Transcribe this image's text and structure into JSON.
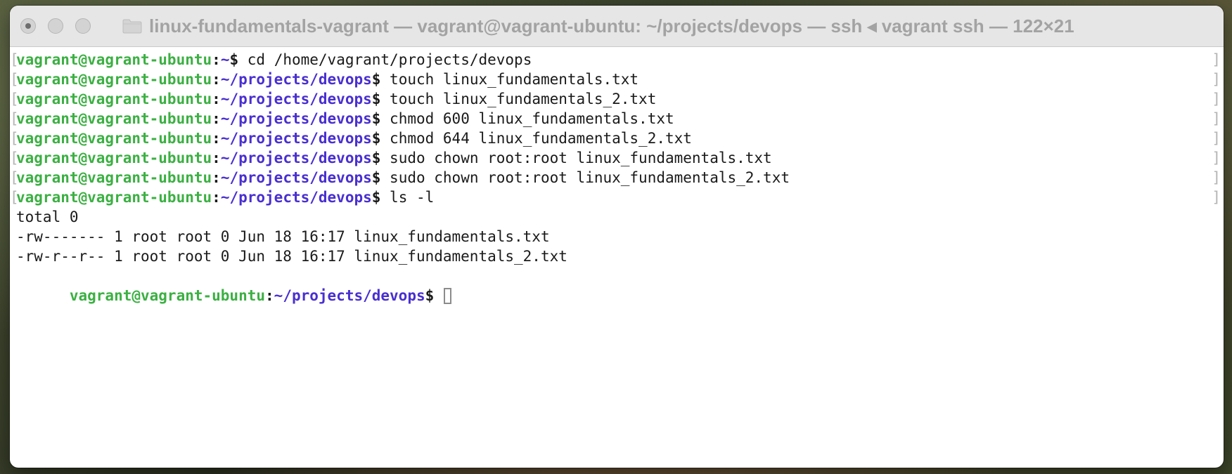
{
  "window": {
    "title": "linux-fundamentals-vagrant — vagrant@vagrant-ubuntu: ~/projects/devops — ssh ◂ vagrant ssh — 122×21",
    "traffic_lights": [
      "close",
      "minimize",
      "zoom"
    ],
    "folder_icon": "folder-icon"
  },
  "colors": {
    "user": "#3cb043",
    "path": "#4a2fd0",
    "text": "#1a1a1a"
  },
  "terminal": {
    "prompt_lines": [
      {
        "user": "vagrant@vagrant-ubuntu",
        "path": "~",
        "command": " cd /home/vagrant/projects/devops"
      },
      {
        "user": "vagrant@vagrant-ubuntu",
        "path": "~/projects/devops",
        "command": " touch linux_fundamentals.txt"
      },
      {
        "user": "vagrant@vagrant-ubuntu",
        "path": "~/projects/devops",
        "command": " touch linux_fundamentals_2.txt"
      },
      {
        "user": "vagrant@vagrant-ubuntu",
        "path": "~/projects/devops",
        "command": " chmod 600 linux_fundamentals.txt"
      },
      {
        "user": "vagrant@vagrant-ubuntu",
        "path": "~/projects/devops",
        "command": " chmod 644 linux_fundamentals_2.txt"
      },
      {
        "user": "vagrant@vagrant-ubuntu",
        "path": "~/projects/devops",
        "command": " sudo chown root:root linux_fundamentals.txt"
      },
      {
        "user": "vagrant@vagrant-ubuntu",
        "path": "~/projects/devops",
        "command": " sudo chown root:root linux_fundamentals_2.txt"
      },
      {
        "user": "vagrant@vagrant-ubuntu",
        "path": "~/projects/devops",
        "command": " ls -l"
      }
    ],
    "output_lines": [
      "total 0",
      "-rw------- 1 root root 0 Jun 18 16:17 linux_fundamentals.txt",
      "-rw-r--r-- 1 root root 0 Jun 18 16:17 linux_fundamentals_2.txt"
    ],
    "final_prompt": {
      "user": "vagrant@vagrant-ubuntu",
      "path": "~/projects/devops",
      "command": " "
    }
  }
}
